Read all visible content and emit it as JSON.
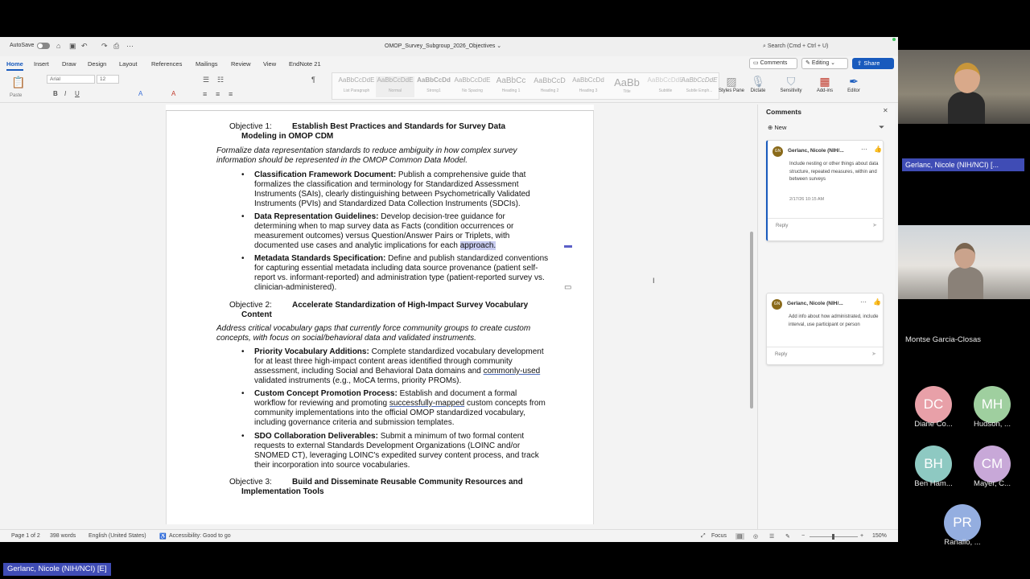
{
  "titlebar": {
    "autosave_label": "AutoSave",
    "doc_title": "OMOP_Survey_Subgroup_2026_Objectives ⌄",
    "search_placeholder": "Search (Cmd + Ctrl + U)"
  },
  "ribbon_tabs": [
    "Home",
    "Insert",
    "Draw",
    "Design",
    "Layout",
    "References",
    "Mailings",
    "Review",
    "View",
    "EndNote 21"
  ],
  "ribbon_actions": {
    "comments_label": "Comments",
    "editing_label": "Editing",
    "share_label": "Share"
  },
  "ribbon": {
    "paste_label": "Paste",
    "font_name": "Arial",
    "font_size": "12",
    "styles": [
      {
        "preview": "AaBbCcDdE",
        "name": "List Paragraph"
      },
      {
        "preview": "AaBbCcDdE",
        "name": "Normal"
      },
      {
        "preview": "AaBbCcDd",
        "name": "Strong1"
      },
      {
        "preview": "AaBbCcDdE",
        "name": "No Spacing"
      },
      {
        "preview": "AaBbCc",
        "name": "Heading 1"
      },
      {
        "preview": "AaBbCcD",
        "name": "Heading 2"
      },
      {
        "preview": "AaBbCcDd",
        "name": "Heading 3"
      },
      {
        "preview": "AaBb",
        "name": "Title"
      },
      {
        "preview": "AaBbCcDdE",
        "name": "Subtitle"
      },
      {
        "preview": "AaBbCcDdE",
        "name": "Subtle Emph..."
      }
    ],
    "styles_pane_label": "Styles Pane",
    "dictate_label": "Dictate",
    "sensitivity_label": "Sensitivity",
    "addins_label": "Add-ins",
    "editor_label": "Editor"
  },
  "document": {
    "objectives": [
      {
        "num": "Objective 1:",
        "title": "Establish Best Practices and Standards for Survey Data",
        "title_cont": "Modeling in OMOP CDM",
        "intro": "Formalize data representation standards to reduce ambiguity in how complex survey information should be represented in the OMOP Common Data Model.",
        "bullets": [
          {
            "head": "Classification Framework Document:",
            "text": " Publish a comprehensive guide that formalizes the classification and terminology for Standardized Assessment Instruments (SAIs), clearly distinguishing between Psychometrically Validated Instruments (PVIs) and Standardized Data Collection Instruments (SDCIs)."
          },
          {
            "head": "Data Representation Guidelines:",
            "text": " Develop decision-tree guidance for determining when to map survey data as Facts (condition occurrences or measurement outcomes) versus Question/Answer Pairs or Triplets, with documented use cases and analytic implications for each ",
            "highlight": "approach."
          },
          {
            "head": "Metadata Standards Specification:",
            "text": " Define and publish standardized conventions for capturing essential metadata including data source provenance (patient self-report vs. informant-reported) and administration type (patient-reported survey vs. clinician-administered)."
          }
        ]
      },
      {
        "num": "Objective 2:",
        "title": "Accelerate Standardization of High-Impact Survey Vocabulary",
        "title_cont": "Content",
        "intro": "Address critical vocabulary gaps that currently force community groups to create custom concepts, with focus on social/behavioral data and validated instruments.",
        "bullets": [
          {
            "head": "Priority Vocabulary Additions:",
            "text_a": " Complete standardized vocabulary development for at least three high-impact content areas identified through community assessment, including Social and Behavioral Data domains and ",
            "underlined": "commonly-used",
            "text_b": " validated instruments (e.g., MoCA terms, priority PROMs)."
          },
          {
            "head": "Custom Concept Promotion Process:",
            "text_a": " Establish and document a formal workflow for reviewing and promoting ",
            "underlined": "successfully-mapped",
            "text_b": " custom concepts from community implementations into the official OMOP standardized vocabulary, including governance criteria and submission templates."
          },
          {
            "head": "SDO Collaboration Deliverables:",
            "text": " Submit a minimum of two formal content requests to external Standards Development Organizations (LOINC and/or SNOMED CT), leveraging LOINC's expedited survey content process, and track their incorporation into source vocabularies."
          }
        ]
      },
      {
        "num": "Objective 3:",
        "title": "Build and Disseminate Reusable Community Resources and",
        "title_cont": "Implementation Tools"
      }
    ]
  },
  "comments_pane": {
    "title": "Comments",
    "new_label": "New",
    "comments": [
      {
        "initials": "GN",
        "author": "Gerlanc, Nicole (NIH/...",
        "body": "Include nesting or other things about data structure, repeated measures, within and between surveys",
        "time": "2/17/26 10:15 AM",
        "reply": "Reply"
      },
      {
        "initials": "GN",
        "author": "Gerlanc, Nicole (NIH/...",
        "body": "Add info about how administrated, include interval, use participant or person",
        "reply": "Reply"
      }
    ]
  },
  "statusbar": {
    "page": "Page 1 of 2",
    "words": "398 words",
    "language": "English (United States)",
    "accessibility": "Accessibility: Good to go",
    "focus": "Focus",
    "zoom": "150%"
  },
  "meeting": {
    "tile1_name": "Gerlanc, Nicole (NIH/NCI) [...",
    "tile2_name": "Montse Garcia-Closas",
    "participants": [
      {
        "initials": "DC",
        "name": "Diane Co...",
        "color": "#e8a0a8"
      },
      {
        "initials": "MH",
        "name": "Hudson, ...",
        "color": "#9fcf9f"
      },
      {
        "initials": "BH",
        "name": "Ben Ham...",
        "color": "#8ec9c2"
      },
      {
        "initials": "CM",
        "name": "Mayer, C...",
        "color": "#c8a8d8"
      },
      {
        "initials": "PR",
        "name": "Ranallo, ...",
        "color": "#94aee0"
      }
    ],
    "active_speaker": "Gerlanc, Nicole (NIH/NCI) [E]"
  }
}
